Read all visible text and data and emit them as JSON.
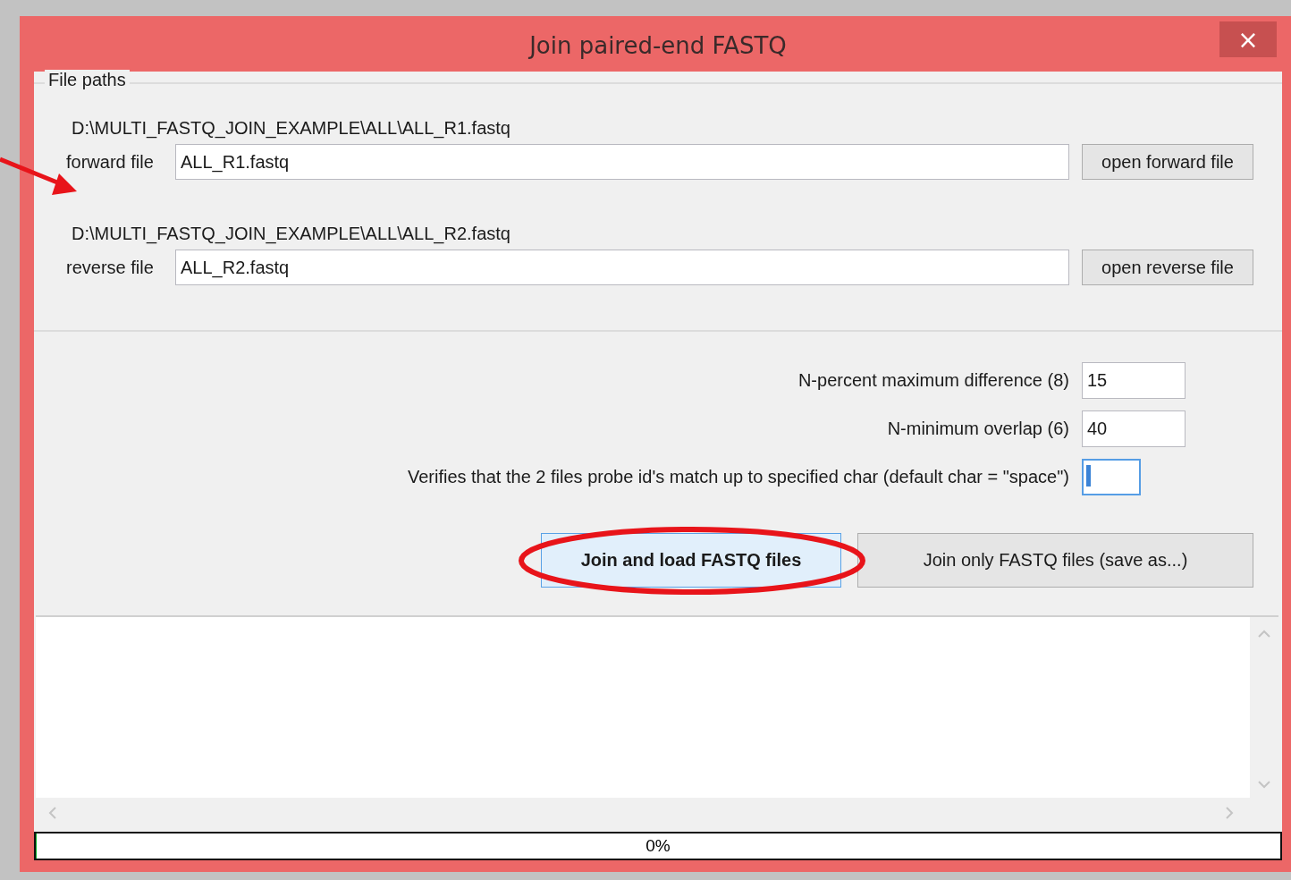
{
  "window": {
    "title": "Join paired-end FASTQ",
    "close": "×"
  },
  "file_paths": {
    "legend": "File paths",
    "files": [
      {
        "path": "D:\\MULTI_FASTQ_JOIN_EXAMPLE\\ALL\\ALL_R1.fastq",
        "label": "forward file",
        "value": "ALL_R1.fastq",
        "button": "open forward file"
      },
      {
        "path": "D:\\MULTI_FASTQ_JOIN_EXAMPLE\\ALL\\ALL_R2.fastq",
        "label": "reverse file",
        "value": "ALL_R2.fastq",
        "button": "open reverse file"
      }
    ]
  },
  "parameters": [
    {
      "kind": "number",
      "label": "N-percent maximum difference (8)",
      "value": "15",
      "focused": false
    },
    {
      "kind": "number",
      "label": "N-minimum overlap (6)",
      "value": "40",
      "focused": false
    },
    {
      "kind": "char",
      "label": "Verifies that the 2 files probe id's match up to specified char (default char = \"space\")",
      "focused": true
    }
  ],
  "actions": [
    {
      "label": "Join and load FASTQ files",
      "default": true
    },
    {
      "label": "Join only FASTQ files (save as...)",
      "default": false
    }
  ],
  "progress": {
    "level": 0,
    "text": "0%"
  }
}
